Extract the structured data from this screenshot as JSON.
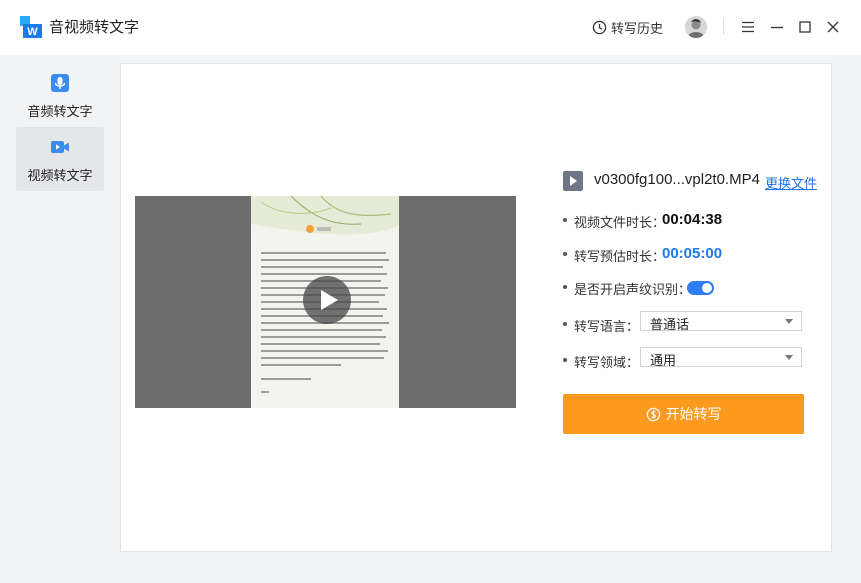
{
  "app": {
    "title": "音视频转文字"
  },
  "header": {
    "history_label": "转写历史"
  },
  "sidebar": {
    "items": [
      {
        "label": "音频转文字",
        "icon": "microphone-icon",
        "active": false
      },
      {
        "label": "视频转文字",
        "icon": "video-camera-icon",
        "active": true
      }
    ]
  },
  "file": {
    "name": "v0300fg100...vpl2t0.MP4",
    "change_label": "更换文件"
  },
  "info": {
    "duration_label": "视频文件时长：",
    "duration_value": "00:04:38",
    "estimate_label": "转写预估时长：",
    "estimate_value": "00:05:00",
    "voiceprint_label": "是否开启声纹识别：",
    "voiceprint_enabled": true,
    "language_label": "转写语言：",
    "language_value": "普通话",
    "domain_label": "转写领域：",
    "domain_value": "通用"
  },
  "action": {
    "start_label": "开始转写"
  },
  "colors": {
    "accent_orange": "#fb9a1f",
    "accent_blue": "#1e7be6",
    "toggle_on": "#2f7df6",
    "sidebar_bg": "#f2f3f5"
  }
}
